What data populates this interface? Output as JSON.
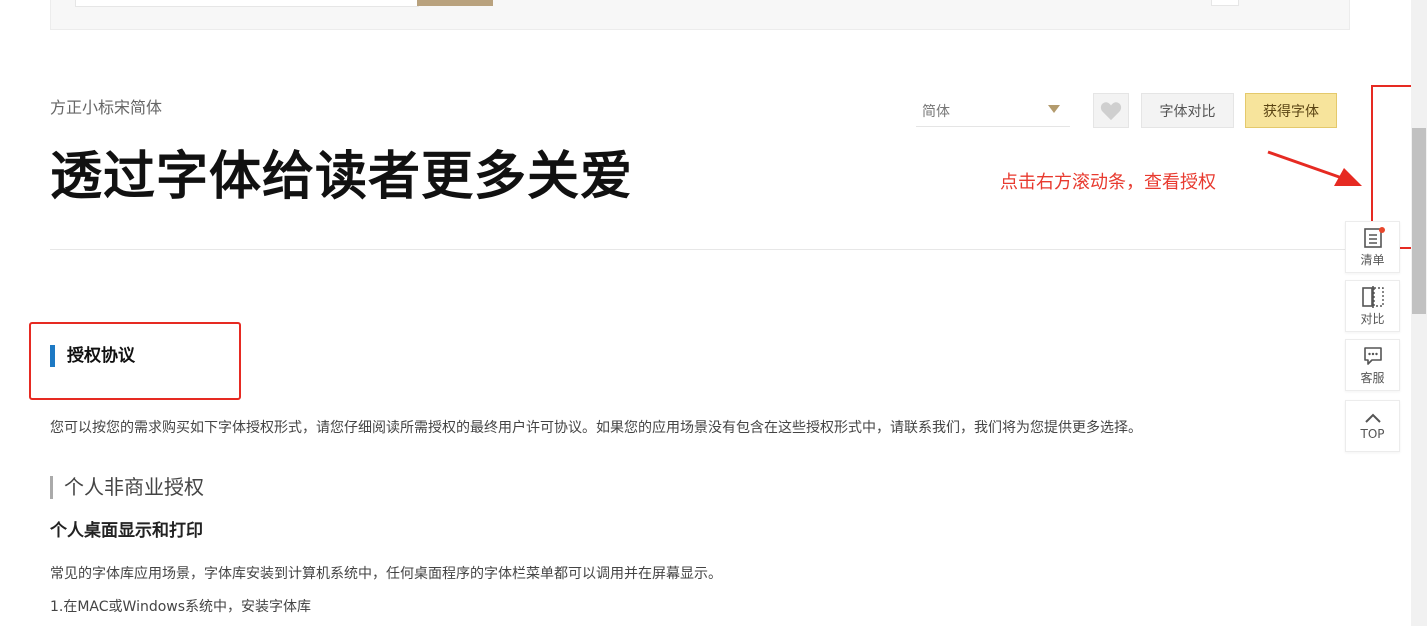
{
  "header": {
    "font_name": "方正小标宋简体",
    "sample_text": "透过字体给读者更多关爱",
    "variant_select": {
      "selected": "简体"
    },
    "compare_label": "字体对比",
    "get_font_label": "获得字体"
  },
  "annotation": {
    "hint": "点击右方滚动条，查看授权",
    "color": "#e83a2f"
  },
  "license": {
    "section_title": "授权协议",
    "intro": "您可以按您的需求购买如下字体授权形式，请您仔细阅读所需授权的最终用户许可协议。如果您的应用场景没有包含在这些授权形式中，请联系我们，我们将为您提供更多选择。",
    "subsection_title": "个人非商业授权",
    "item_title": "个人桌面显示和打印",
    "item_desc": "常见的字体库应用场景，字体库安装到计算机系统中，任何桌面程序的字体栏菜单都可以调用并在屏幕显示。",
    "item_step_1": "1.在MAC或Windows系统中，安装字体库"
  },
  "side_tools": {
    "list_label": "清单",
    "compare_label": "对比",
    "service_label": "客服",
    "top_label": "TOP"
  },
  "colors": {
    "accent_blue": "#1d79c4",
    "get_button_bg": "#f7e49c",
    "annotation_red": "#e62a22"
  }
}
